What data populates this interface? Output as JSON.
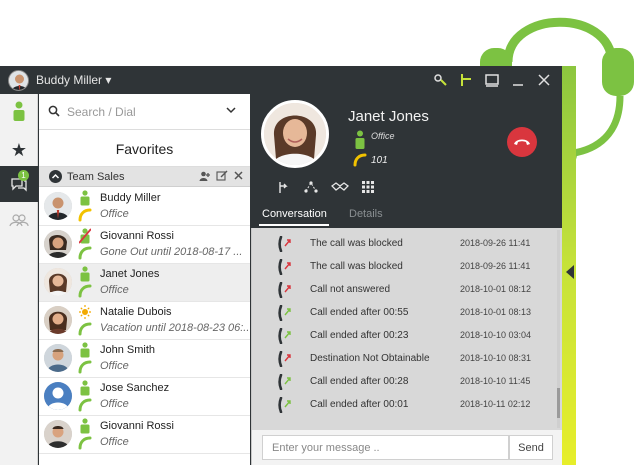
{
  "app": {
    "user_name": "Buddy Miller",
    "title_controls": [
      "agent-icon",
      "transfer-icon",
      "window-icon",
      "minimize-icon",
      "close-icon"
    ]
  },
  "nav": {
    "items": [
      {
        "name": "presence",
        "icon": "person-icon"
      },
      {
        "name": "favorites",
        "icon": "star-icon"
      },
      {
        "name": "chat",
        "icon": "chat-icon",
        "badge": "1"
      },
      {
        "name": "groups",
        "icon": "group-icon"
      }
    ]
  },
  "search": {
    "placeholder": "Search / Dial"
  },
  "favorites": {
    "title": "Favorites",
    "team": {
      "name": "Team Sales"
    },
    "contacts": [
      {
        "name": "Buddy Miller",
        "status": "Office",
        "presence": "#7cc242",
        "selected": false
      },
      {
        "name": "Giovanni Rossi",
        "status": "Gone Out until 2018-08-17 ...",
        "presence": "#7cc242",
        "selected": false
      },
      {
        "name": "Janet Jones",
        "status": "Office",
        "presence": "#7cc242",
        "selected": true
      },
      {
        "name": "Natalie Dubois",
        "status": "Vacation until 2018-08-23 06:...",
        "presence": "#7cc242",
        "selected": false
      },
      {
        "name": "John Smith",
        "status": "Office",
        "presence": "#7cc242",
        "selected": false
      },
      {
        "name": "Jose Sanchez",
        "status": "Office",
        "presence": "#7cc242",
        "selected": false
      },
      {
        "name": "Giovanni Rossi",
        "status": "Office",
        "presence": "#7cc242",
        "selected": false
      }
    ]
  },
  "call": {
    "name": "Janet Jones",
    "location": "Office",
    "extension": "101",
    "tabs": {
      "conversation": "Conversation",
      "details": "Details"
    }
  },
  "history": [
    {
      "text": "The call was blocked",
      "time": "2018-09-26 11:41",
      "kind": "missed"
    },
    {
      "text": "The call was blocked",
      "time": "2018-09-26 11:41",
      "kind": "missed"
    },
    {
      "text": "Call not answered",
      "time": "2018-10-01 08:12",
      "kind": "missed"
    },
    {
      "text": "Call ended after 00:55",
      "time": "2018-10-01 08:13",
      "kind": "ok"
    },
    {
      "text": "Call ended after 00:23",
      "time": "2018-10-10 03:04",
      "kind": "ok"
    },
    {
      "text": "Destination Not Obtainable",
      "time": "2018-10-10 08:31",
      "kind": "missed"
    },
    {
      "text": "Call ended after 00:28",
      "time": "2018-10-10 11:45",
      "kind": "ok"
    },
    {
      "text": "Call ended after 00:01",
      "time": "2018-10-11 02:12",
      "kind": "ok"
    }
  ],
  "composer": {
    "placeholder": "Enter your message ..",
    "send_label": "Send"
  },
  "colors": {
    "accent": "#7cc242",
    "hangup": "#d9363e",
    "missed": "#d9363e",
    "dark": "#2f3437"
  }
}
